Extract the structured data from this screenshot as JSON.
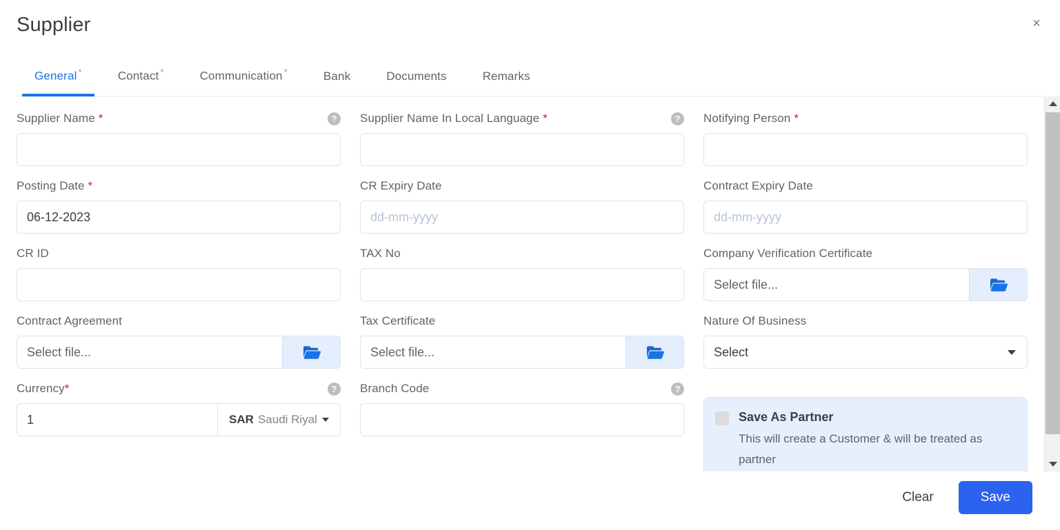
{
  "header": {
    "title": "Supplier",
    "close_label": "×"
  },
  "tabs": [
    {
      "label": "General",
      "required_mark": "*",
      "active": true
    },
    {
      "label": "Contact",
      "required_mark": "*",
      "active": false
    },
    {
      "label": "Communication",
      "required_mark": "*",
      "active": false
    },
    {
      "label": "Bank",
      "required_mark": "",
      "active": false
    },
    {
      "label": "Documents",
      "required_mark": "",
      "active": false
    },
    {
      "label": "Remarks",
      "required_mark": "",
      "active": false
    }
  ],
  "form": {
    "supplier_name": {
      "label": "Supplier Name",
      "required": "*",
      "value": "",
      "placeholder": ""
    },
    "supplier_name_local": {
      "label": "Supplier Name In Local Language",
      "required": "*",
      "value": "",
      "placeholder": ""
    },
    "notifying_person": {
      "label": "Notifying Person",
      "required": "*",
      "value": "",
      "placeholder": ""
    },
    "posting_date": {
      "label": "Posting Date",
      "required": "*",
      "value": "06-12-2023",
      "placeholder": "dd-mm-yyyy"
    },
    "cr_expiry_date": {
      "label": "CR Expiry Date",
      "required": "",
      "value": "",
      "placeholder": "dd-mm-yyyy"
    },
    "contract_expiry_date": {
      "label": "Contract Expiry Date",
      "required": "",
      "value": "",
      "placeholder": "dd-mm-yyyy"
    },
    "cr_id": {
      "label": "CR ID",
      "required": "",
      "value": "",
      "placeholder": ""
    },
    "tax_no": {
      "label": "TAX No",
      "required": "",
      "value": "",
      "placeholder": ""
    },
    "company_verification_certificate": {
      "label": "Company Verification Certificate",
      "required": "",
      "file_text": "Select file..."
    },
    "contract_agreement": {
      "label": "Contract Agreement",
      "required": "",
      "file_text": "Select file..."
    },
    "tax_certificate": {
      "label": "Tax Certificate",
      "required": "",
      "file_text": "Select file..."
    },
    "nature_of_business": {
      "label": "Nature Of Business",
      "required": "",
      "value": "Select"
    },
    "currency": {
      "label": "Currency",
      "required": "*",
      "amount": "1",
      "code": "SAR",
      "name": "Saudi Riyal"
    },
    "branch_code": {
      "label": "Branch Code",
      "required": "",
      "value": "",
      "placeholder": ""
    }
  },
  "partner_panel": {
    "title": "Save As Partner",
    "description": "This will create a Customer & will be treated as partner",
    "checked": false
  },
  "footer": {
    "clear_label": "Clear",
    "save_label": "Save"
  },
  "colors": {
    "accent": "#1a73e8",
    "save_button": "#2b62f0",
    "required_asterisk": "#c5221f",
    "panel_background": "#e6effc",
    "file_button_background": "#e4eefc",
    "label_text": "#5f6368",
    "placeholder_date": "#b6c4da"
  }
}
